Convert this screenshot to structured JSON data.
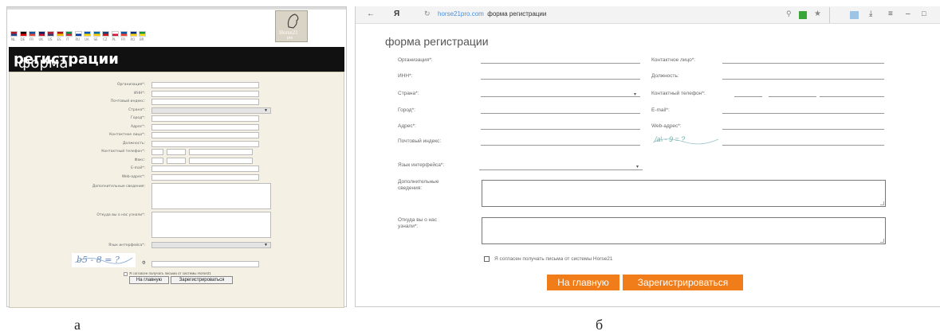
{
  "panel_a": {
    "flag_codes": [
      "NL",
      "DE",
      "FR",
      "UK",
      "US",
      "ES",
      "IT",
      "RU",
      "UA",
      "SE",
      "CZ",
      "PL",
      "FR",
      "RO",
      "BR"
    ],
    "logo_text": "Horse21",
    "logo_sub": "pro",
    "banner_title_light": "форма ",
    "banner_title_bold": "регистрации",
    "labels": {
      "org": "Организация*:",
      "inn": "ИНН*:",
      "zip": "Почтовый индекс:",
      "country": "Страна*:",
      "city": "Город*:",
      "address": "Адрес*:",
      "contact": "Контактное лицо*:",
      "position": "Должность:",
      "phone": "Контактный телефон*:",
      "fax": "Факс:",
      "email": "E-mail*:",
      "web": "Web-адрес*:",
      "extra": "Дополнительные сведения:",
      "source": "Откуда вы о нас узнали*:",
      "lang": "Язык интерфейса*:"
    },
    "captcha_text": "b5 - 8 = ?",
    "captcha_symbol": "Ф",
    "consent": "Я согласен получать письма от системы Horse21",
    "btn_home": "На главную",
    "btn_register": "Зарегистрироваться"
  },
  "panel_b": {
    "nav_back": "←",
    "browser_logo": "Я",
    "reload_icon": "↻",
    "url_domain": "horse21pro.com",
    "url_title": "форма регистрации",
    "title": "форма регистрации",
    "left_labels": {
      "org": "Организация*:",
      "inn": "ИНН*:",
      "country": "Страна*:",
      "city": "Город*:",
      "address": "Адрес*:",
      "zip": "Почтовый индекс:"
    },
    "right_labels": {
      "contact": "Контактное лицо*:",
      "position": "Должность:",
      "phone": "Контактный телефон*:",
      "email": "E-mail*:",
      "web": "Web-адрес*:"
    },
    "captcha_text": "/a\\ - 9 = ?",
    "lang_label": "Язык интерфейса*:",
    "extra_label": "Дополнительные сведения:",
    "source_label": "Откуда вы о нас узнали*:",
    "consent": "Я согласен получать письма от системы Horse21",
    "btn_home": "На главную",
    "btn_register": "Зарегистрироваться",
    "accent_color": "#f07d1a"
  },
  "captions": {
    "a": "а",
    "b": "б"
  }
}
